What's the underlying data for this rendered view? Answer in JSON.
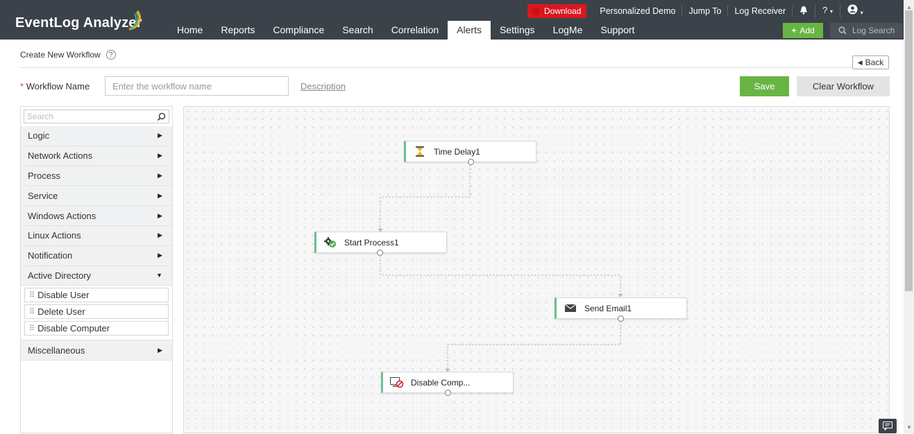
{
  "app": {
    "brand": "EventLog Analyzer"
  },
  "nav": {
    "items": [
      "Home",
      "Reports",
      "Compliance",
      "Search",
      "Correlation",
      "Alerts",
      "Settings",
      "LogMe",
      "Support"
    ],
    "active": "Alerts"
  },
  "topbar": {
    "download": "Download",
    "links": [
      "Personalized Demo",
      "Jump To",
      "Log Receiver"
    ],
    "help": "?",
    "add": "Add",
    "log_search": "Log Search"
  },
  "header": {
    "title": "Create New Workflow",
    "help": "?",
    "back": "Back",
    "required_mark": "*",
    "workflow_name_label": "Workflow Name",
    "workflow_name_value": "",
    "workflow_name_placeholder": "Enter the workflow name",
    "description_link": "Description",
    "save": "Save",
    "clear": "Clear Workflow"
  },
  "panel": {
    "search_placeholder": "Search",
    "categories": [
      "Logic",
      "Network Actions",
      "Process",
      "Service",
      "Windows Actions",
      "Linux Actions",
      "Notification",
      "Active Directory",
      "Miscellaneous"
    ],
    "expanded": "Active Directory",
    "active_directory_actions": [
      "Disable User",
      "Delete User",
      "Disable Computer"
    ]
  },
  "workflow": {
    "nodes": [
      "Time Delay1",
      "Start Process1",
      "Send Email1",
      "Disable Comp..."
    ]
  },
  "colors": {
    "accent_green": "#68b545",
    "node_border": "#68c28f",
    "topbar": "#3b4249",
    "download_red": "#d9181f"
  }
}
